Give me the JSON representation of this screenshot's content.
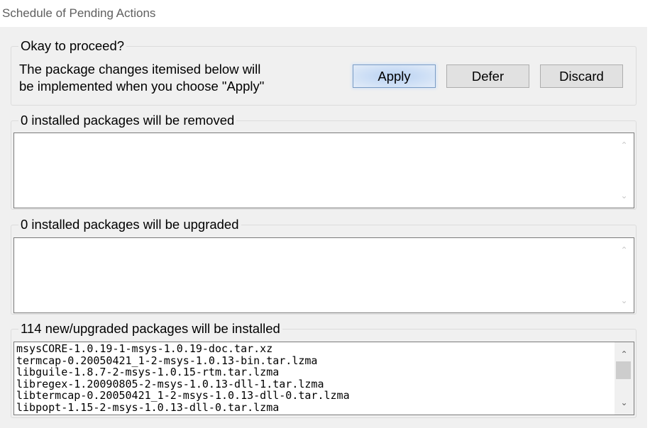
{
  "window": {
    "title": "Schedule of Pending Actions"
  },
  "proceed": {
    "title": "Okay to proceed?",
    "description_line1": "The package changes itemised below will",
    "description_line2": "be implemented when you choose \"Apply\"",
    "apply_label": "Apply",
    "defer_label": "Defer",
    "discard_label": "Discard"
  },
  "removed": {
    "title": "0 installed packages will be removed",
    "items": []
  },
  "upgraded": {
    "title": "0 installed packages will be upgraded",
    "items": []
  },
  "installed": {
    "title": "114 new/upgraded packages will be installed",
    "items": [
      "msysCORE-1.0.19-1-msys-1.0.19-doc.tar.xz",
      "termcap-0.20050421_1-2-msys-1.0.13-bin.tar.lzma",
      "libguile-1.8.7-2-msys-1.0.15-rtm.tar.lzma",
      "libregex-1.20090805-2-msys-1.0.13-dll-1.tar.lzma",
      "libtermcap-0.20050421_1-2-msys-1.0.13-dll-0.tar.lzma",
      "libpopt-1.15-2-msys-1.0.13-dll-0.tar.lzma"
    ]
  },
  "icons": {
    "scroll_up": "chevron-up-icon",
    "scroll_down": "chevron-down-icon"
  },
  "colors": {
    "default_button": "#cfe0f6",
    "dialog_background": "#f0f0f0"
  }
}
